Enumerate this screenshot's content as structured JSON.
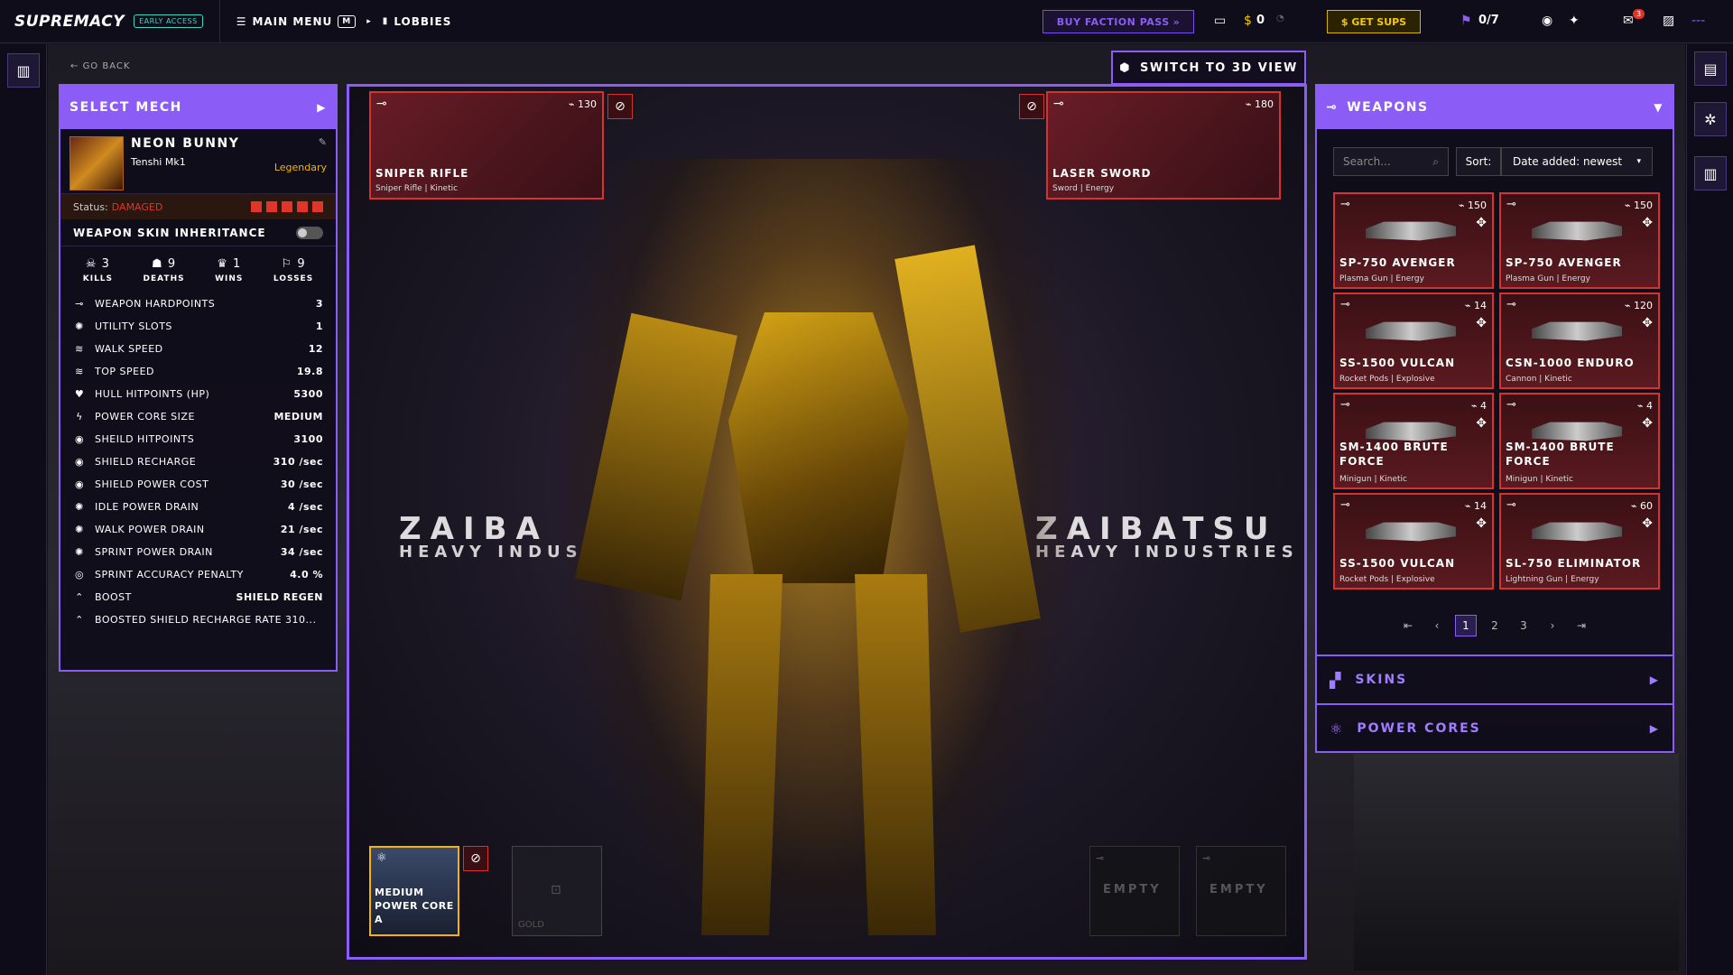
{
  "topbar": {
    "logo": "SUPREMACY",
    "badge": "EARLY ACCESS",
    "main_menu": "MAIN MENU",
    "main_menu_key": "M",
    "breadcrumb_arrow": "▸",
    "lobbies": "LOBBIES",
    "faction_pass": "BUY FACTION PASS",
    "balance": "0",
    "get_sups": "GET SUPS",
    "quest_progress": "0/7",
    "notifications_count": "3",
    "more": "---"
  },
  "go_back": "GO BACK",
  "switch_view": "SWITCH TO 3D VIEW",
  "select_mech": {
    "header": "SELECT MECH",
    "name": "NEON BUNNY",
    "model": "Tenshi Mk1",
    "rarity": "Legendary",
    "status_label": "Status:",
    "status_value": "DAMAGED",
    "weapon_skin_inheritance": "WEAPON SKIN INHERITANCE",
    "kills": "3",
    "kills_label": "KILLS",
    "deaths": "9",
    "deaths_label": "DEATHS",
    "wins": "1",
    "wins_label": "WINS",
    "losses": "9",
    "losses_label": "LOSSES",
    "stats": [
      {
        "label": "WEAPON HARDPOINTS",
        "value": "3"
      },
      {
        "label": "UTILITY SLOTS",
        "value": "1"
      },
      {
        "label": "WALK SPEED",
        "value": "12"
      },
      {
        "label": "TOP SPEED",
        "value": "19.8"
      },
      {
        "label": "HULL HITPOINTS (HP)",
        "value": "5300"
      },
      {
        "label": "POWER CORE SIZE",
        "value": "MEDIUM"
      },
      {
        "label": "SHEILD HITPOINTS",
        "value": "3100"
      },
      {
        "label": "SHIELD RECHARGE",
        "value": "310 /sec"
      },
      {
        "label": "SHIELD POWER COST",
        "value": "30 /sec"
      },
      {
        "label": "IDLE POWER DRAIN",
        "value": "4 /sec"
      },
      {
        "label": "WALK POWER DRAIN",
        "value": "21 /sec"
      },
      {
        "label": "SPRINT POWER DRAIN",
        "value": "34 /sec"
      },
      {
        "label": "SPRINT ACCURACY PENALTY",
        "value": "4.0 %"
      },
      {
        "label": "BOOST",
        "value": "SHIELD REGEN"
      },
      {
        "label": "BOOSTED SHIELD RECHARGE RATE 310...",
        "value": ""
      }
    ]
  },
  "viewport": {
    "brand_left": "ZAIBA",
    "brand_left_sub": "HEAVY INDUSTRIES",
    "brand_right": "ZAIBATSU",
    "brand_right_sub": "HEAVY INDUSTRIES",
    "slot_left": {
      "name": "SNIPER RIFLE",
      "type": "Sniper Rifle | Kinetic",
      "count": "130"
    },
    "slot_right": {
      "name": "LASER SWORD",
      "type": "Sword | Energy",
      "count": "180"
    },
    "power_core": "MEDIUM POWER CORE A",
    "gold": "GOLD",
    "empty1": "EMPTY",
    "empty2": "EMPTY"
  },
  "weapons_panel": {
    "header": "WEAPONS",
    "search_placeholder": "Search...",
    "sort_label": "Sort:",
    "sort_value": "Date added: newest",
    "items": [
      {
        "name": "SP-750 AVENGER",
        "type": "Plasma Gun | Energy",
        "count": "150"
      },
      {
        "name": "SP-750 AVENGER",
        "type": "Plasma Gun | Energy",
        "count": "150"
      },
      {
        "name": "SS-1500 VULCAN",
        "type": "Rocket Pods | Explosive",
        "count": "14"
      },
      {
        "name": "CSN-1000 ENDURO",
        "type": "Cannon | Kinetic",
        "count": "120"
      },
      {
        "name": "SM-1400 BRUTE FORCE",
        "type": "Minigun | Kinetic",
        "count": "4"
      },
      {
        "name": "SM-1400 BRUTE FORCE",
        "type": "Minigun | Kinetic",
        "count": "4"
      },
      {
        "name": "SS-1500 VULCAN",
        "type": "Rocket Pods | Explosive",
        "count": "14"
      },
      {
        "name": "SL-750 ELIMINATOR",
        "type": "Lightning Gun | Energy",
        "count": "60"
      }
    ],
    "pages": [
      "1",
      "2",
      "3"
    ],
    "skins": "SKINS",
    "power_cores": "POWER CORES"
  },
  "colors": {
    "accent": "#8b5cf6",
    "danger": "#d8322e",
    "gold": "#f5c800",
    "rarity": "#f5b400"
  }
}
